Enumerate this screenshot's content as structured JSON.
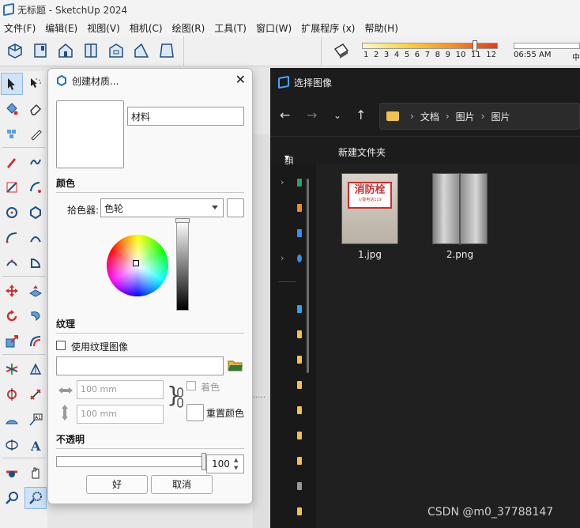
{
  "app": {
    "title": "无标题 - SketchUp 2024"
  },
  "menubar": {
    "items": [
      "文件(F)",
      "编辑(E)",
      "视图(V)",
      "相机(C)",
      "绘图(R)",
      "工具(T)",
      "窗口(W)",
      "扩展程序 (x)",
      "帮助(H)"
    ]
  },
  "toolbar": {
    "month_ticks": [
      "1",
      "2",
      "3",
      "4",
      "5",
      "6",
      "7",
      "8",
      "9",
      "10",
      "11",
      "12"
    ],
    "time_start": "06:55 AM",
    "time_mid": "中"
  },
  "material_dialog": {
    "title": "创建材质...",
    "name_value": "材料",
    "color_section": "颜色",
    "picker_label": "拾色器:",
    "picker_value": "色轮",
    "texture_section": "纹理",
    "use_texture_label": "使用纹理图像",
    "texture_path": "",
    "width_placeholder": "100 mm",
    "height_placeholder": "100 mm",
    "colorize_label": "着色",
    "reset_color_label": "重置颜色",
    "opacity_section": "不透明",
    "opacity_value": "100",
    "ok_label": "好",
    "cancel_label": "取消",
    "use_texture_checked": false,
    "colorize_checked": false,
    "opacity_fraction": 1.0
  },
  "file_dialog": {
    "title": "选择图像",
    "breadcrumb": [
      "文档",
      "图片",
      "图片"
    ],
    "organize_label": "组织",
    "new_folder_label": "新建文件夹",
    "files": [
      {
        "name": "1.jpg",
        "thumb_text": "消防栓",
        "thumb_subtext": "火警电话119"
      },
      {
        "name": "2.png"
      }
    ]
  },
  "watermark": "CSDN @m0_37788147",
  "colors": {
    "file_dialog_bg": "#202020",
    "accent": "#2a6fb6",
    "folder": "#f2c14e"
  }
}
